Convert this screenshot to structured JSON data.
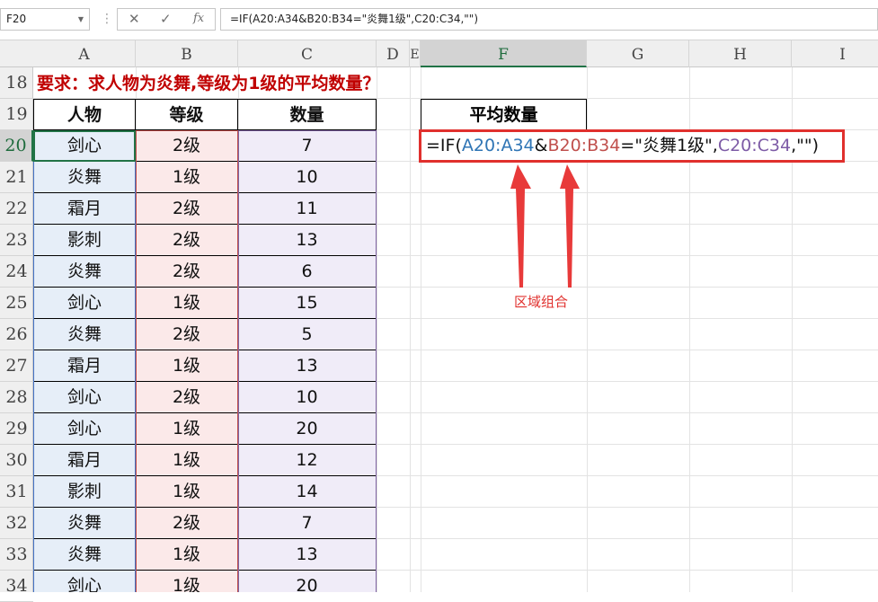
{
  "name_box": "F20",
  "formula_bar": {
    "cancel_icon": "✕",
    "enter_icon": "✓",
    "fx_label": "fx",
    "formula": "=IF(A20:A34&B20:B34=\"炎舞1级\",C20:C34,\"\")"
  },
  "columns": [
    "A",
    "B",
    "C",
    "D",
    "E",
    "F",
    "G",
    "H",
    "I"
  ],
  "rows": [
    "18",
    "19",
    "20",
    "21",
    "22",
    "23",
    "24",
    "25",
    "26",
    "27",
    "28",
    "29",
    "30",
    "31",
    "32",
    "33",
    "34"
  ],
  "requirement": "要求：求人物为炎舞,等级为1级的平均数量？",
  "table": {
    "headers": [
      "人物",
      "等级",
      "数量"
    ],
    "rows": [
      [
        "剑心",
        "2级",
        "7"
      ],
      [
        "炎舞",
        "1级",
        "10"
      ],
      [
        "霜月",
        "2级",
        "11"
      ],
      [
        "影刺",
        "2级",
        "13"
      ],
      [
        "炎舞",
        "2级",
        "6"
      ],
      [
        "剑心",
        "1级",
        "15"
      ],
      [
        "炎舞",
        "2级",
        "5"
      ],
      [
        "霜月",
        "1级",
        "13"
      ],
      [
        "剑心",
        "2级",
        "10"
      ],
      [
        "剑心",
        "1级",
        "20"
      ],
      [
        "霜月",
        "1级",
        "12"
      ],
      [
        "影刺",
        "1级",
        "14"
      ],
      [
        "炎舞",
        "2级",
        "7"
      ],
      [
        "炎舞",
        "1级",
        "13"
      ],
      [
        "剑心",
        "1级",
        "20"
      ]
    ]
  },
  "f_header": "平均数量",
  "formula_cell": {
    "p1": "=IF(",
    "p2": "A20:A34",
    "p3": "&",
    "p4": "B20:B34",
    "p5": "=\"炎舞1级\",",
    "p6": "C20:C34",
    "p7": ",\"\")"
  },
  "annotation": "区域组合",
  "colors": {
    "range_a": "#2f75b5",
    "range_b": "#c0504d",
    "range_c": "#7d5ba6",
    "annotation_red": "#e0302d",
    "selection_green": "#217346"
  }
}
